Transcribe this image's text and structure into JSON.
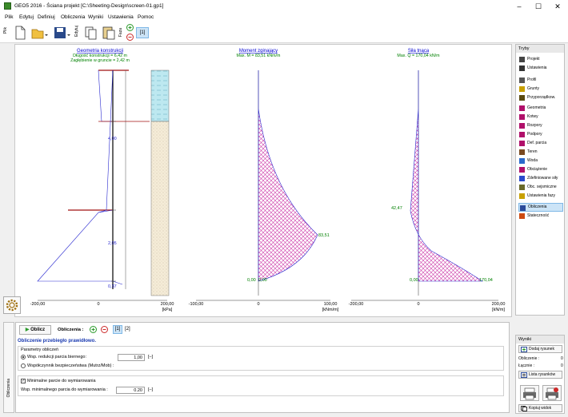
{
  "window": {
    "title": "GEO5 2016 - Ściana projekt [C:\\Sheeting-Design\\screen-01.gp1]",
    "minimize": "–",
    "maximize": "☐",
    "close": "✕"
  },
  "menu": [
    "Plik",
    "Edytuj",
    "Definiuj",
    "Obliczenia",
    "Wyniki",
    "Ustawienia",
    "Pomoc"
  ],
  "toolbar": {
    "plik_label": "Plik",
    "edytuj_label": "Edytuj",
    "faza_label": "Faza",
    "stage_label": "[1]"
  },
  "chart_data": [
    {
      "type": "diagram",
      "title": "Geometria konstrukcji",
      "subtitle1": "Długość konstrukcji = 6,42 m",
      "subtitle2": "Zagłębienie w gruncie = 2,42 m",
      "depth_labels": [
        "4,00",
        "2,05",
        "0,37"
      ],
      "xticks": [
        "-200,00",
        "0",
        "200,00"
      ],
      "unit": "[kPa]"
    },
    {
      "type": "area",
      "title": "Moment zginający",
      "subtitle": "Max. M = 83,51 kNm/m",
      "annotations": [
        "83,51",
        "0,00",
        "0,00"
      ],
      "xticks": [
        "-100,00",
        "0",
        "100,00"
      ],
      "unit": "[kNm/m]"
    },
    {
      "type": "area",
      "title": "Siła tnąca",
      "subtitle": "Max. Q = 170,04 kN/m",
      "annotations": [
        "42,47",
        "0,00",
        "170,04"
      ],
      "xticks": [
        "-200,00",
        "0",
        "200,00"
      ],
      "unit": "[kN/m]"
    }
  ],
  "rightpanel": {
    "header": "Tryby",
    "items": [
      {
        "label": "Projekt",
        "icon": "document-icon",
        "color": "#444444"
      },
      {
        "label": "Ustawienia",
        "icon": "gear-icon",
        "color": "#333333"
      },
      {
        "label": "Profil",
        "icon": "profile-icon",
        "color": "#555555"
      },
      {
        "label": "Grunty",
        "icon": "soil-icon",
        "color": "#c8a000"
      },
      {
        "label": "Przyporządkow.",
        "icon": "assign-icon",
        "color": "#5a4a10"
      },
      {
        "label": "Geometria",
        "icon": "geometry-icon",
        "color": "#b0106a"
      },
      {
        "label": "Kotwy",
        "icon": "anchor-icon",
        "color": "#b0106a"
      },
      {
        "label": "Rozpory",
        "icon": "strut-icon",
        "color": "#b0106a"
      },
      {
        "label": "Podpory",
        "icon": "support-icon",
        "color": "#b0106a"
      },
      {
        "label": "Def. parcia",
        "icon": "pressure-icon",
        "color": "#b0106a"
      },
      {
        "label": "Teren",
        "icon": "terrain-icon",
        "color": "#7a4a20"
      },
      {
        "label": "Woda",
        "icon": "water-icon",
        "color": "#2a6acc"
      },
      {
        "label": "Obciążenie",
        "icon": "load-icon",
        "color": "#b0106a"
      },
      {
        "label": "Zdefiniowane siły",
        "icon": "force-icon",
        "color": "#2a4acc"
      },
      {
        "label": "Obc. sejsmiczne",
        "icon": "seismic-icon",
        "color": "#6a6a2a"
      },
      {
        "label": "Ustawienia fazy",
        "icon": "stage-settings-icon",
        "color": "#c8a000"
      },
      {
        "label": "Obliczenia",
        "icon": "analysis-icon",
        "color": "#2a4a9a"
      },
      {
        "label": "Stateczność",
        "icon": "stability-icon",
        "color": "#cc4a10"
      }
    ]
  },
  "bottom": {
    "side_label": "Obliczenia",
    "compute_button": "Oblicz",
    "calc_label": "Obliczenia :",
    "calc_tabs": [
      "[1]",
      "[2]"
    ],
    "status": "Obliczenie przebiegło prawidłowo.",
    "group_title": "Parametry obliczeń",
    "radio1": "Wsp. redukcji parcia biernego:",
    "radio1_value": "1,00",
    "radio1_unit": "[–]",
    "radio2": "Współczynnik bezpieczeństwa (Mutrz/Mob) :",
    "checkbox": "Minimalne parcie do wymiarowania",
    "min_label": "Wsp. minimalnego parcia do wymiarowania :",
    "min_value": "0.20",
    "min_unit": "[–]"
  },
  "results": {
    "header": "Wyniki",
    "add_button": "Dodaj rysunek",
    "calc_label": "Obliczenie :",
    "calc_value": "0",
    "total_label": "Łącznie :",
    "total_value": "0",
    "list_button": "Lista rysunków",
    "copy_button": "Kopiuj widok"
  }
}
